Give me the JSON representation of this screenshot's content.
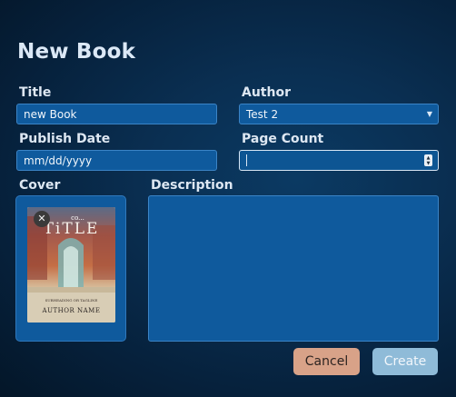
{
  "dialog": {
    "title": "New Book"
  },
  "form": {
    "title_label": "Title",
    "title_value": "new Book",
    "author_label": "Author",
    "author_value": "Test 2",
    "publish_date_label": "Publish Date",
    "publish_date_placeholder": "mm/dd/yyyy",
    "page_count_label": "Page Count",
    "page_count_value": "",
    "cover_label": "Cover",
    "description_label": "Description",
    "description_value": ""
  },
  "cover": {
    "remove_icon": "close-icon",
    "top_text": "co...",
    "title_text": "TiTLE",
    "tagline_text": "SUBHEADING OR TAGLINE",
    "author_text": "AUTHOR NAME"
  },
  "buttons": {
    "cancel": "Cancel",
    "create": "Create"
  },
  "colors": {
    "background": "#0a2f52",
    "field": "#0f5a9d",
    "cancel": "#d8a288",
    "create": "#8fbbd8"
  }
}
